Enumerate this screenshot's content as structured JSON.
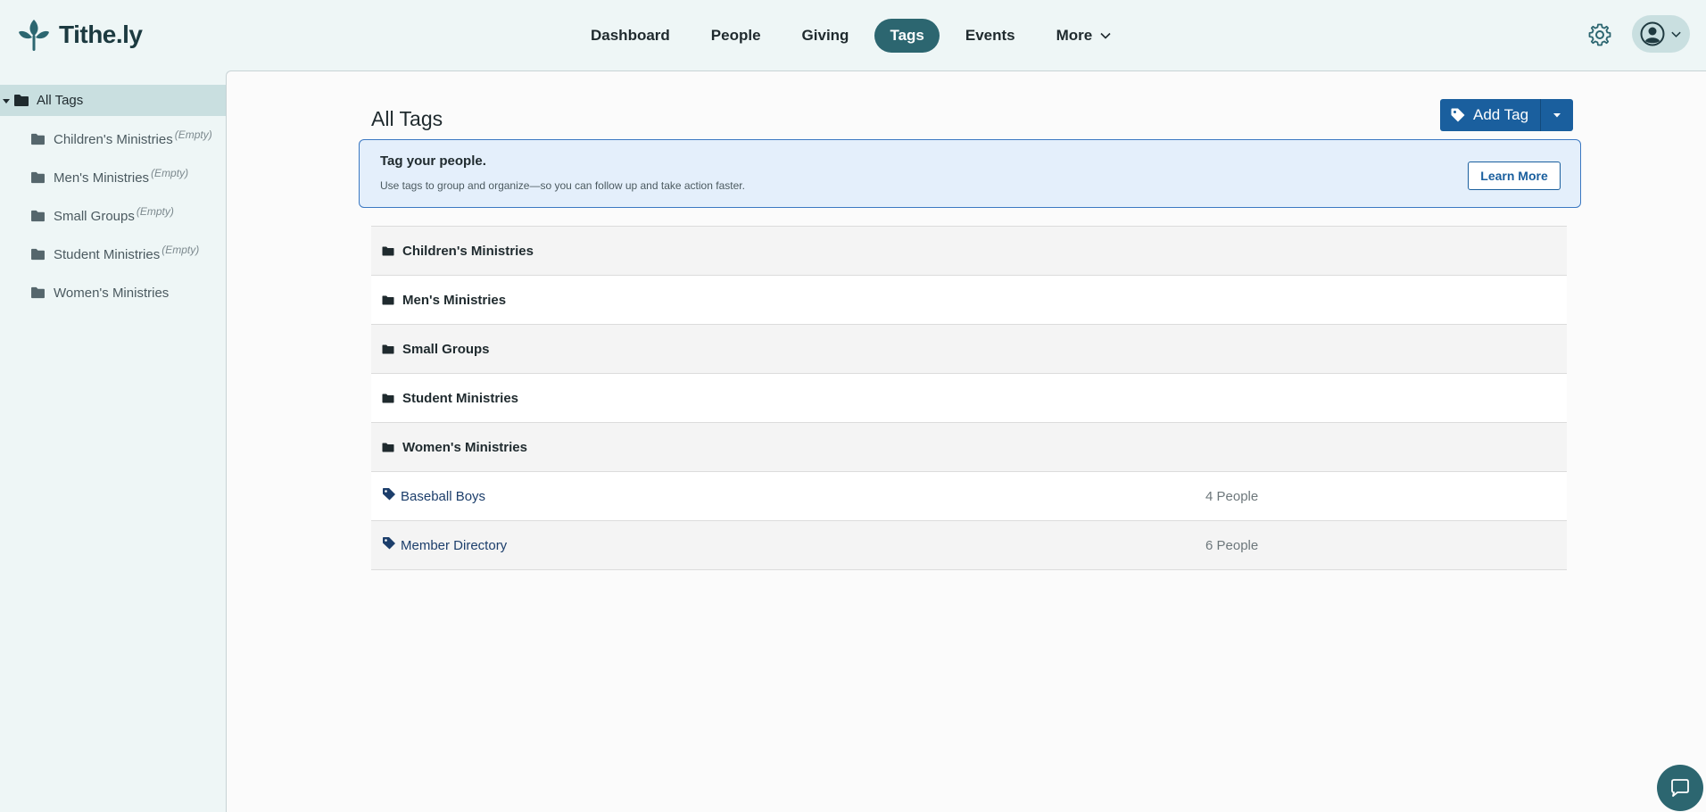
{
  "app": {
    "name": "Tithe.ly"
  },
  "nav": {
    "items": [
      {
        "label": "Dashboard",
        "active": false
      },
      {
        "label": "People",
        "active": false
      },
      {
        "label": "Giving",
        "active": false
      },
      {
        "label": "Tags",
        "active": true
      },
      {
        "label": "Events",
        "active": false
      },
      {
        "label": "More",
        "active": false,
        "dropdown": true
      }
    ]
  },
  "sidebar": {
    "root": "All Tags",
    "items": [
      {
        "label": "Children's Ministries",
        "badge": "(Empty)"
      },
      {
        "label": "Men's Ministries",
        "badge": "(Empty)"
      },
      {
        "label": "Small Groups",
        "badge": "(Empty)"
      },
      {
        "label": "Student Ministries",
        "badge": "(Empty)"
      },
      {
        "label": "Women's Ministries",
        "badge": ""
      }
    ]
  },
  "main": {
    "title": "All Tags",
    "add_tag_label": "Add Tag",
    "banner": {
      "title": "Tag your people.",
      "text": "Use tags to group and organize—so you can follow up and take action faster.",
      "button": "Learn More"
    },
    "folders": [
      "Children's Ministries",
      "Men's Ministries",
      "Small Groups",
      "Student Ministries",
      "Women's Ministries"
    ],
    "tags": [
      {
        "name": "Baseball Boys",
        "count": "4 People"
      },
      {
        "name": "Member Directory",
        "count": "6 People"
      }
    ]
  },
  "colors": {
    "accent": "#2c6670",
    "primary_button": "#1a5f9e",
    "banner_bg": "#e4effb",
    "sidebar_bg": "#eef6f6"
  },
  "icons": [
    "leaf-logo-icon",
    "chevron-down-icon",
    "gear-icon",
    "user-avatar-icon",
    "folder-icon",
    "tag-icon",
    "caret-down-icon",
    "chat-icon"
  ]
}
